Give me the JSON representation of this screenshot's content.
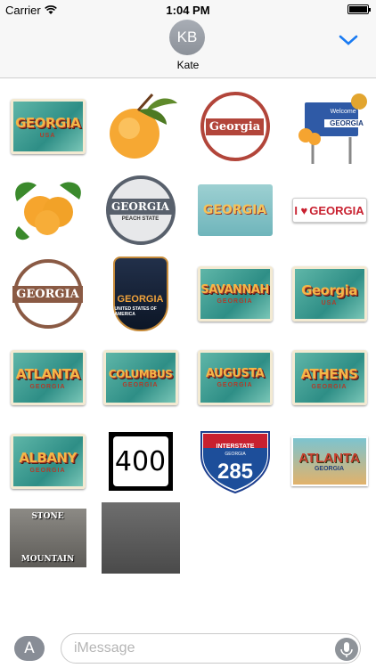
{
  "status": {
    "carrier": "Carrier",
    "time": "1:04 PM"
  },
  "header": {
    "avatar_initials": "KB",
    "contact_name": "Kate"
  },
  "stickers": [
    {
      "big": "GEORGIA",
      "small": "USA"
    },
    {
      "type": "peach"
    },
    {
      "big": "Georgia"
    },
    {
      "sign": "Welcome to",
      "name": "GEORGIA"
    },
    {
      "type": "peaches"
    },
    {
      "big": "GEORGIA",
      "small": "PEACH STATE"
    },
    {
      "big": "GEORGIA"
    },
    {
      "big": "GEORGIA"
    },
    {
      "big": "GEORGIA"
    },
    {
      "big": "GEORGIA",
      "small": "UNITED STATES OF AMERICA"
    },
    {
      "big": "SAVANNAH",
      "small": "GEORGIA"
    },
    {
      "big": "Georgia",
      "small": "USA"
    },
    {
      "big": "ATLANTA",
      "small": "GEORGIA"
    },
    {
      "big": "COLUMBUS",
      "small": "GEORGIA"
    },
    {
      "big": "AUGUSTA",
      "small": "GEORGIA"
    },
    {
      "big": "ATHENS",
      "small": "GEORGIA"
    },
    {
      "big": "ALBANY",
      "small": "GEORGIA"
    },
    {
      "big": "400"
    },
    {
      "top": "INTERSTATE",
      "state": "GEORGIA",
      "big": "285"
    },
    {
      "big": "ATLANTA",
      "small": "GEORGIA"
    },
    {
      "top": "STONE",
      "bottom": "MOUNTAIN"
    },
    {
      "type": "stone-relief"
    }
  ],
  "input": {
    "placeholder": "iMessage"
  },
  "colors": {
    "accent": "#1a7bf2"
  }
}
